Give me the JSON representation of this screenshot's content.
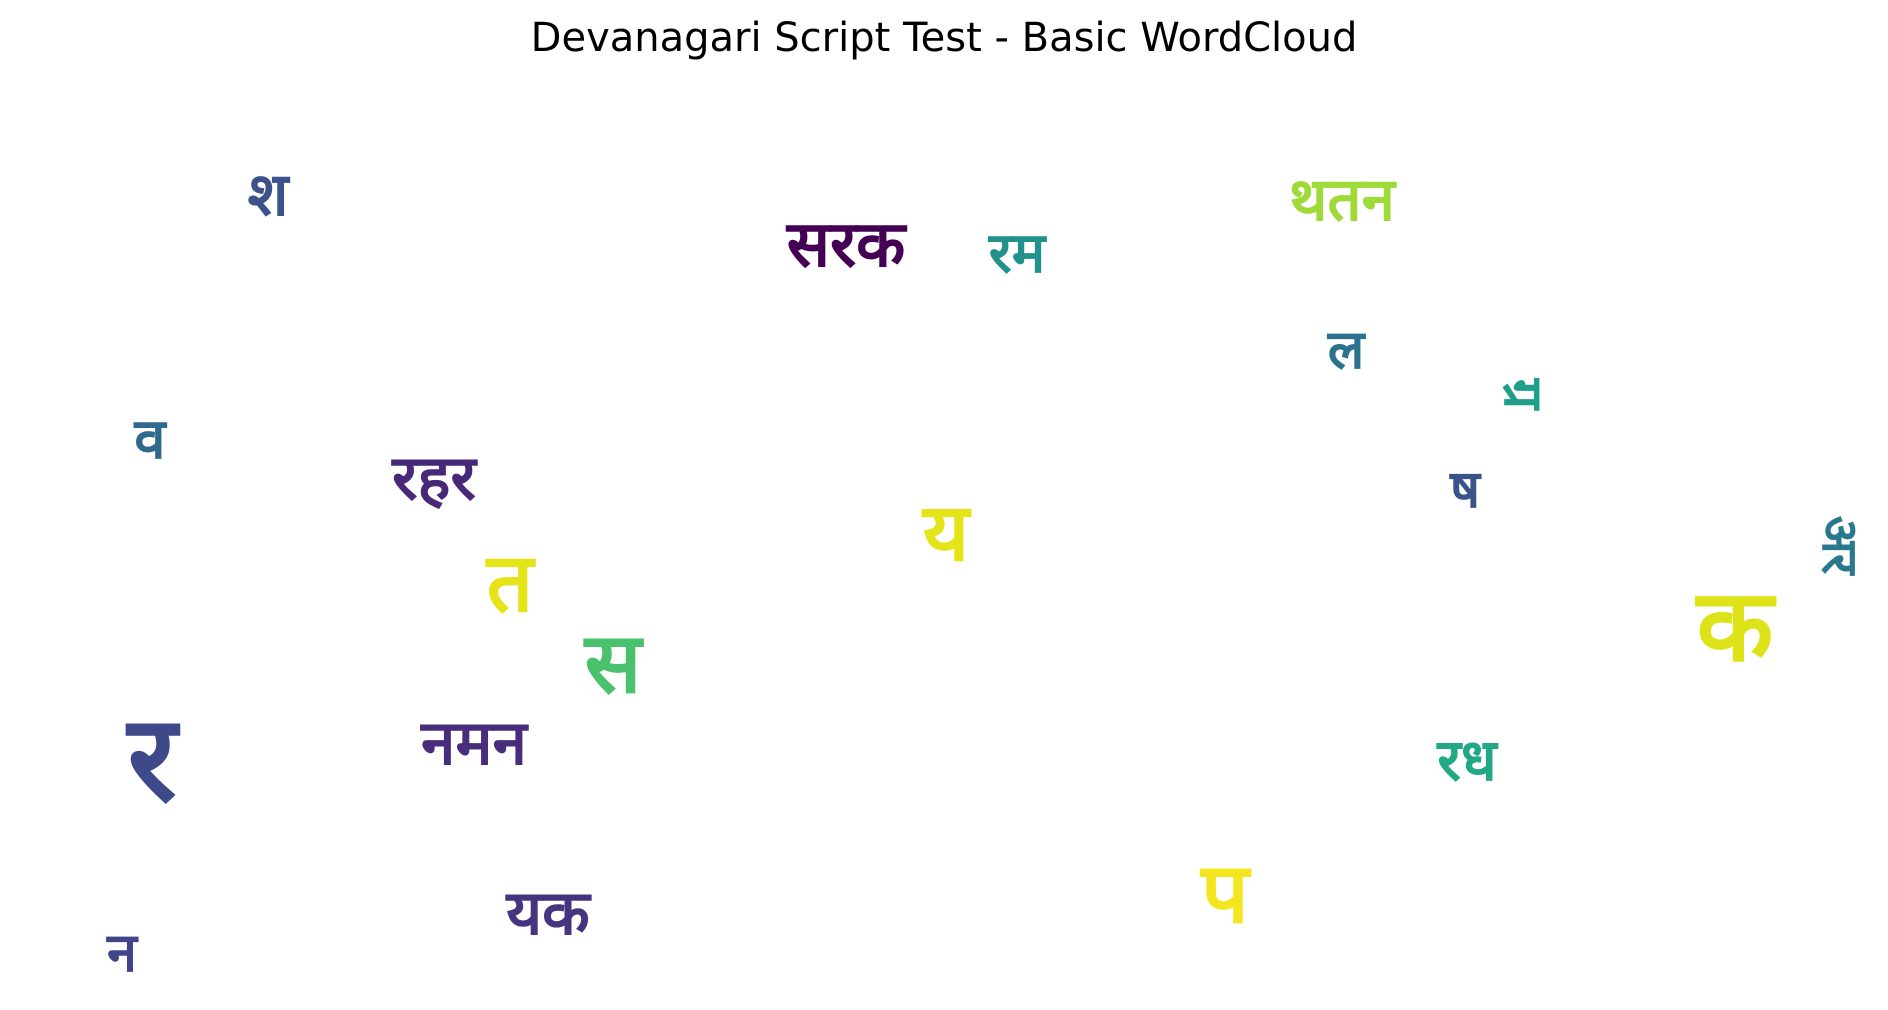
{
  "title": "Devanagari Script Test - Basic WordCloud",
  "words": [
    {
      "text": "श",
      "color": "#3b528b"
    },
    {
      "text": "सरक",
      "color": "#440154"
    },
    {
      "text": "रम",
      "color": "#21918c"
    },
    {
      "text": "थतन",
      "color": "#a0da39"
    },
    {
      "text": "ल",
      "color": "#2c728e"
    },
    {
      "text": "ग्र",
      "color": "#1f9e89"
    },
    {
      "text": "व",
      "color": "#31688e"
    },
    {
      "text": "रहर",
      "color": "#482878"
    },
    {
      "text": "ष",
      "color": "#3b528b"
    },
    {
      "text": "य",
      "color": "#e5e419"
    },
    {
      "text": "अर",
      "color": "#2a788e"
    },
    {
      "text": "त",
      "color": "#e5e419"
    },
    {
      "text": "क",
      "color": "#dde318"
    },
    {
      "text": "स",
      "color": "#4ac16d"
    },
    {
      "text": "र",
      "color": "#3e4989"
    },
    {
      "text": "नमन",
      "color": "#472d7b"
    },
    {
      "text": "रध",
      "color": "#22a884"
    },
    {
      "text": "प",
      "color": "#f4e61e"
    },
    {
      "text": "यक",
      "color": "#463480"
    },
    {
      "text": "न",
      "color": "#414487"
    }
  ]
}
